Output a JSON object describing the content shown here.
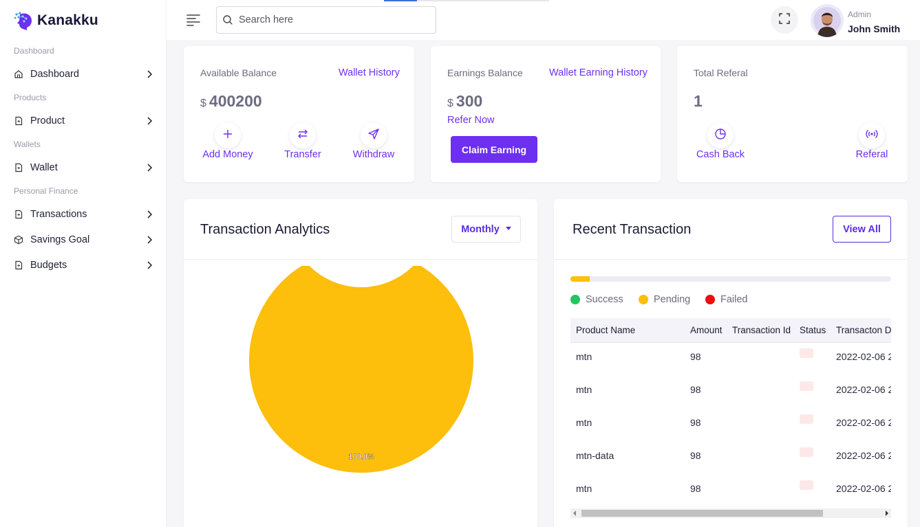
{
  "app": {
    "name": "Kanakku"
  },
  "colors": {
    "accent": "#6d2ff0",
    "success": "#22c55e",
    "pending": "#fdbe0c",
    "failed": "#ef0c0c"
  },
  "sidebar": {
    "sections": [
      {
        "title": "Dashboard",
        "items": [
          {
            "label": "Dashboard",
            "icon": "home-icon"
          }
        ]
      },
      {
        "title": "Products",
        "items": [
          {
            "label": "Product",
            "icon": "file-icon"
          }
        ]
      },
      {
        "title": "Wallets",
        "items": [
          {
            "label": "Wallet",
            "icon": "file-icon"
          }
        ]
      },
      {
        "title": "Personal Finance",
        "items": [
          {
            "label": "Transactions",
            "icon": "file-icon"
          },
          {
            "label": "Savings Goal",
            "icon": "box-icon"
          },
          {
            "label": "Budgets",
            "icon": "file-icon"
          }
        ]
      }
    ]
  },
  "header": {
    "search_placeholder": "Search here",
    "user": {
      "role": "Admin",
      "name": "John Smith"
    }
  },
  "cards": {
    "balance": {
      "label": "Available Balance",
      "link": "Wallet History",
      "currency": "$",
      "amount": "400200",
      "actions": [
        {
          "label": "Add Money",
          "icon": "plus-icon"
        },
        {
          "label": "Transfer",
          "icon": "transfer-icon"
        },
        {
          "label": "Withdraw",
          "icon": "send-icon"
        }
      ]
    },
    "earnings": {
      "label": "Earnings Balance",
      "link": "Wallet Earning History",
      "currency": "$",
      "amount": "300",
      "refer": "Refer Now",
      "button": "Claim Earning"
    },
    "referral": {
      "label": "Total Referal",
      "count": "1",
      "actions": [
        {
          "label": "Cash Back",
          "icon": "pie-icon"
        },
        {
          "label": "Referal",
          "icon": "broadcast-icon"
        }
      ]
    }
  },
  "analytics": {
    "title": "Transaction Analytics",
    "period": "Monthly"
  },
  "chart_data": {
    "type": "pie",
    "donut": true,
    "slices": [
      {
        "label": "Pending",
        "value": 100.0,
        "color": "#fdbe0c"
      }
    ],
    "data_labels": [
      "100.0%"
    ]
  },
  "recent": {
    "title": "Recent Transaction",
    "view_all": "View All",
    "progress": {
      "pending_fraction": 0.06
    },
    "legend": [
      {
        "label": "Success",
        "color": "#22c55e"
      },
      {
        "label": "Pending",
        "color": "#fdbe0c"
      },
      {
        "label": "Failed",
        "color": "#ef0c0c"
      }
    ],
    "columns": [
      "Product Name",
      "Amount",
      "Transaction Id",
      "Status",
      "Transacton Date"
    ],
    "rows": [
      {
        "product": "mtn",
        "amount": "98",
        "txid": "",
        "date": "2022-02-06 2"
      },
      {
        "product": "mtn",
        "amount": "98",
        "txid": "",
        "date": "2022-02-06 2"
      },
      {
        "product": "mtn",
        "amount": "98",
        "txid": "",
        "date": "2022-02-06 2"
      },
      {
        "product": "mtn-data",
        "amount": "98",
        "txid": "",
        "date": "2022-02-06 2"
      },
      {
        "product": "mtn",
        "amount": "98",
        "txid": "",
        "date": "2022-02-06 2"
      }
    ]
  }
}
